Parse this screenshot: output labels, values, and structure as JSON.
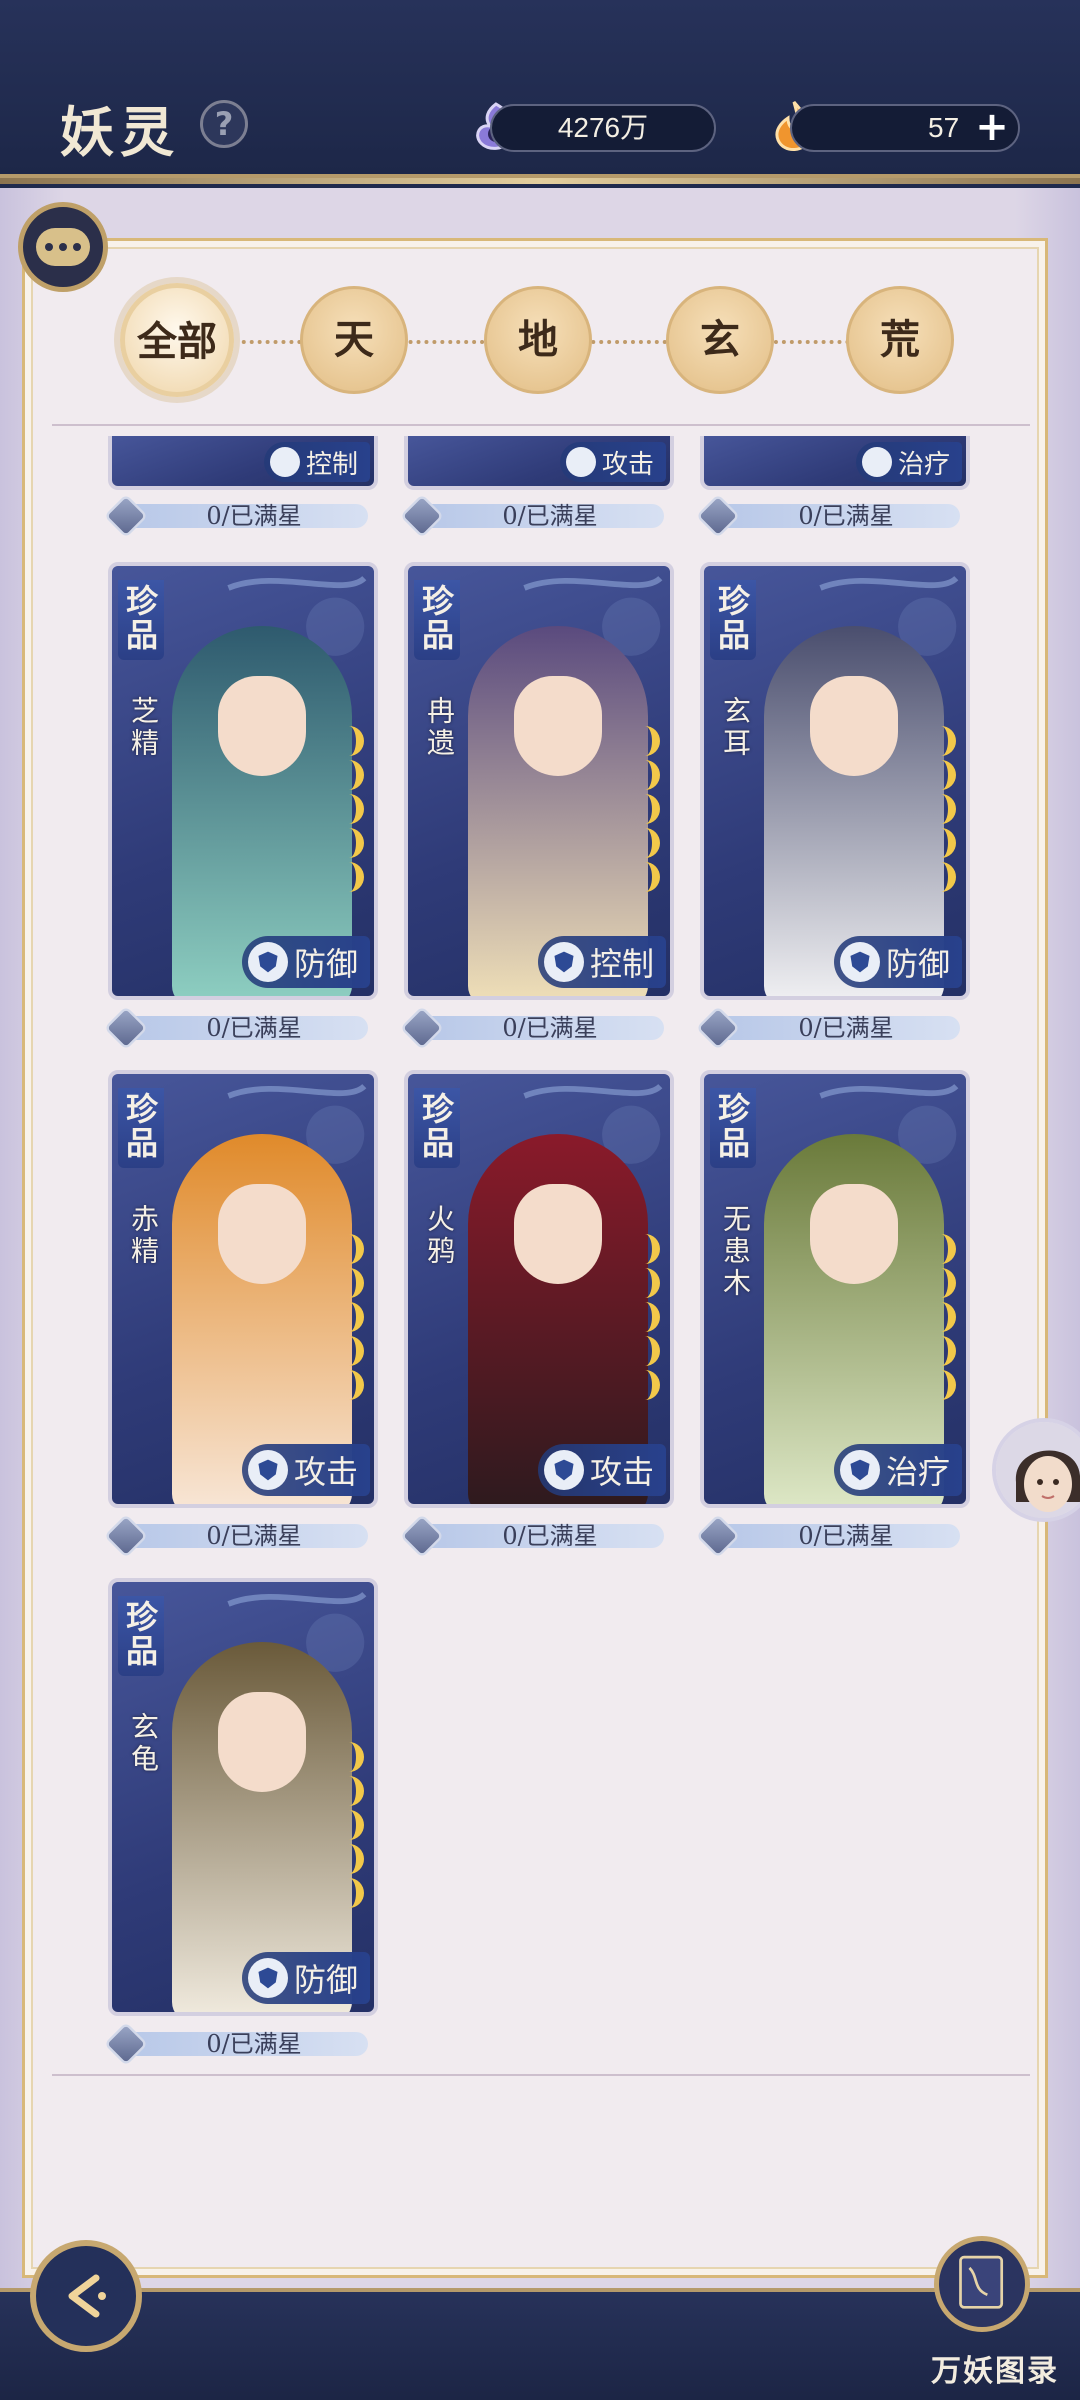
{
  "header": {
    "title": "妖灵",
    "help_icon": "question-icon",
    "resource_1": {
      "value": "4276万",
      "icon": "purple-orb-icon"
    },
    "resource_2": {
      "value": "57",
      "icon": "orange-flame-icon",
      "add_label": "+"
    }
  },
  "tabs": [
    {
      "label": "全部",
      "active": true
    },
    {
      "label": "天"
    },
    {
      "label": "地"
    },
    {
      "label": "玄"
    },
    {
      "label": "荒"
    }
  ],
  "partial_row": [
    {
      "role": "控制",
      "stars_text": "0/已满星"
    },
    {
      "role": "攻击",
      "stars_text": "0/已满星"
    },
    {
      "role": "治疗",
      "stars_text": "0/已满星"
    }
  ],
  "cards": [
    {
      "grade": "珍品",
      "name": "芝精",
      "role": "防御",
      "stars_text": "0/已满星",
      "stars": 5
    },
    {
      "grade": "珍品",
      "name": "冉遗",
      "role": "控制",
      "stars_text": "0/已满星",
      "stars": 5
    },
    {
      "grade": "珍品",
      "name": "玄耳",
      "role": "防御",
      "stars_text": "0/已满星",
      "stars": 5
    },
    {
      "grade": "珍品",
      "name": "赤精",
      "role": "攻击",
      "stars_text": "0/已满星",
      "stars": 5
    },
    {
      "grade": "珍品",
      "name": "火鸦",
      "role": "攻击",
      "stars_text": "0/已满星",
      "stars": 5
    },
    {
      "grade": "珍品",
      "name": "无患木",
      "role": "治疗",
      "stars_text": "0/已满星",
      "stars": 5
    },
    {
      "grade": "珍品",
      "name": "玄龟",
      "role": "防御",
      "stars_text": "0/已满星",
      "stars": 5
    }
  ],
  "bottom": {
    "back_icon": "back-arrow-icon",
    "atlas_label": "万妖图录",
    "atlas_icon": "book-icon"
  },
  "colors": {
    "accent_gold": "#d8b878",
    "header_bg": "#1d2748",
    "card_bg": "#2f3b78",
    "star": "#f2c84a"
  }
}
